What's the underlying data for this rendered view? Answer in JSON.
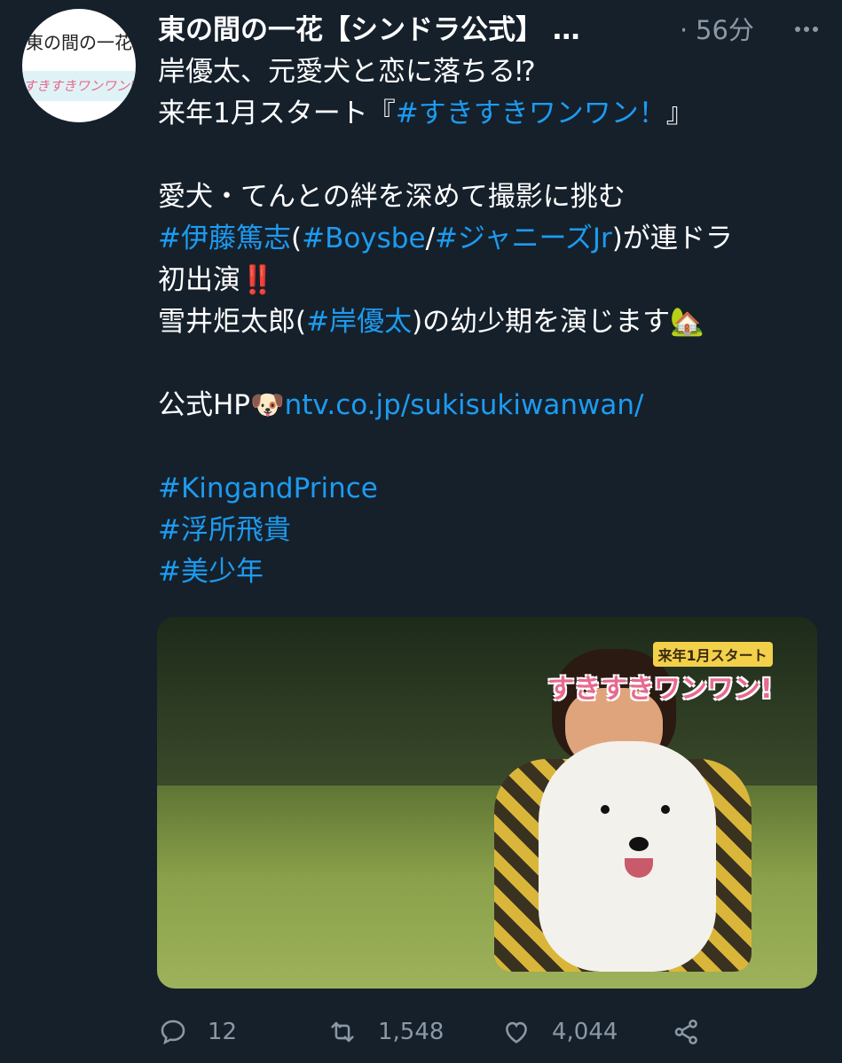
{
  "author": {
    "avatar_top": "東の間の一花",
    "avatar_bottom": "すきすきワンワン!",
    "display_name": "東の間の一花【シンドラ公式】 …",
    "separator": "·",
    "timestamp": "56分"
  },
  "tweet": {
    "line1": "岸優太、元愛犬と恋に落ちる⁉",
    "line2_a": "来年1月スタート『",
    "line2_tag": "#すきすきワンワン！",
    "line2_b": "』",
    "line3": "愛犬・てんとの絆を深めて撮影に挑む",
    "line4_tag1": "#伊藤篤志",
    "line4_p1": "(",
    "line4_tag2": "#Boysbe",
    "line4_slash": "/",
    "line4_tag3": "#ジャニーズJr",
    "line4_p2": ")が連ドラ",
    "line5": "初出演‼️",
    "line6_a": "雪井炬太郎(",
    "line6_tag": "#岸優太",
    "line6_b": ")の幼少期を演じます🏡",
    "line7_a": "公式HP🐶",
    "line7_link": "ntv.co.jp/sukisukiwanwan/",
    "hashtag1": "#KingandPrince",
    "hashtag2": "#浮所飛貴",
    "hashtag3": "#美少年"
  },
  "media": {
    "logo_small": "来年1月スタート",
    "logo_big": "すきすきワンワン!"
  },
  "actions": {
    "reply_icon": "reply-icon",
    "reply_count": "12",
    "retweet_icon": "retweet-icon",
    "retweet_count": "1,548",
    "like_icon": "heart-icon",
    "like_count": "4,044",
    "share_icon": "share-icon"
  },
  "colors": {
    "background": "#15202b",
    "link": "#1d9bf0",
    "muted": "#8b98a5"
  }
}
